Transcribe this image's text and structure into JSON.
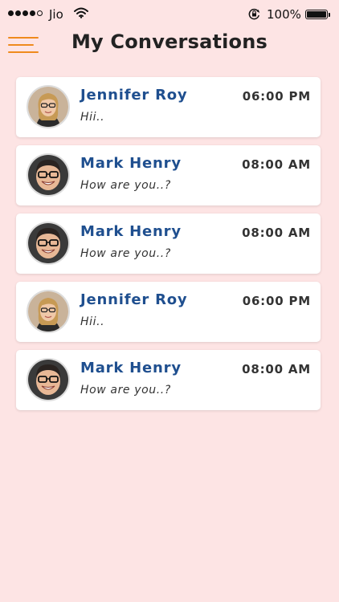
{
  "status_bar": {
    "carrier": "Jio",
    "battery": "100%",
    "signal_bars": 4,
    "signal_total": 5
  },
  "header": {
    "title": "My Conversations",
    "menu_icon": "hamburger-menu-icon",
    "accent_color": "#ef8a1d"
  },
  "colors": {
    "background": "#fde4e4",
    "name": "#1f4f8f"
  },
  "conversations": [
    {
      "name": "Jennifer Roy",
      "time": "06:00 PM",
      "message": "Hii..",
      "avatar": "female"
    },
    {
      "name": "Mark Henry",
      "time": "08:00 AM",
      "message": "How are you..?",
      "avatar": "male"
    },
    {
      "name": "Mark Henry",
      "time": "08:00 AM",
      "message": "How are you..?",
      "avatar": "male"
    },
    {
      "name": "Jennifer Roy",
      "time": "06:00 PM",
      "message": "Hii..",
      "avatar": "female"
    },
    {
      "name": "Mark Henry",
      "time": "08:00 AM",
      "message": "How are you..?",
      "avatar": "male"
    }
  ]
}
